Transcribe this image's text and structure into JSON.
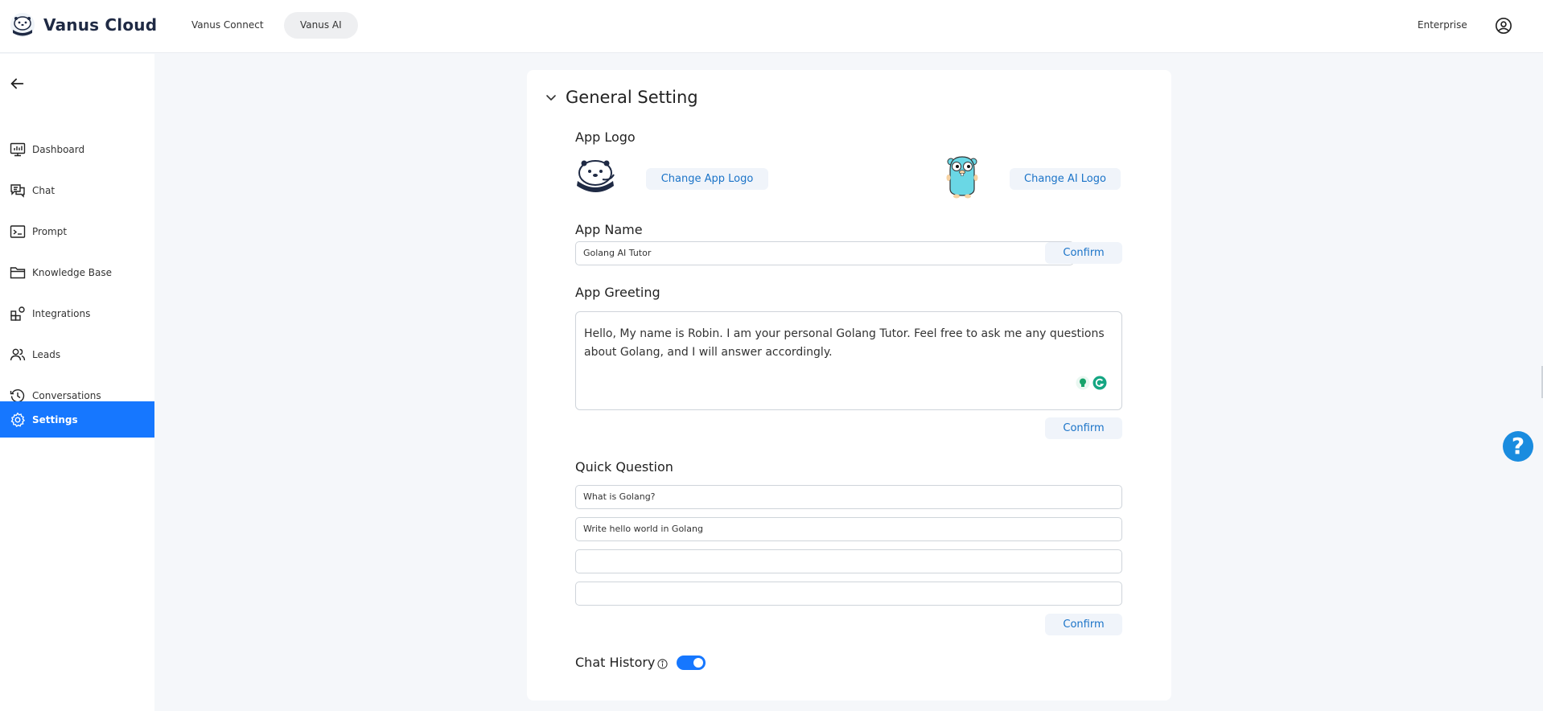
{
  "header": {
    "brand": "Vanus Cloud",
    "tabs": [
      {
        "label": "Vanus Connect",
        "active": false
      },
      {
        "label": "Vanus AI",
        "active": true
      }
    ],
    "enterprise": "Enterprise"
  },
  "sidebar": {
    "items": [
      {
        "label": "Dashboard",
        "icon": "dashboard-icon"
      },
      {
        "label": "Chat",
        "icon": "chat-icon"
      },
      {
        "label": "Prompt",
        "icon": "prompt-icon"
      },
      {
        "label": "Knowledge Base",
        "icon": "folder-icon"
      },
      {
        "label": "Integrations",
        "icon": "integrations-icon"
      },
      {
        "label": "Leads",
        "icon": "users-icon"
      },
      {
        "label": "Conversations",
        "icon": "history-icon"
      },
      {
        "label": "Settings",
        "icon": "gear-icon",
        "active": true
      }
    ]
  },
  "settings": {
    "section_title": "General Setting",
    "app_logo": {
      "label": "App Logo",
      "change_app_logo": "Change App Logo",
      "change_ai_logo": "Change AI Logo"
    },
    "app_name": {
      "label": "App Name",
      "value": "Golang AI Tutor",
      "confirm": "Confirm"
    },
    "app_greeting": {
      "label": "App Greeting",
      "value": "Hello, My name is Robin. I am your personal Golang Tutor. Feel free to ask me any questions about Golang, and I will answer accordingly.",
      "confirm": "Confirm"
    },
    "quick_question": {
      "label": "Quick Question",
      "items": [
        "What is Golang?",
        "Write hello world in Golang",
        "",
        ""
      ],
      "confirm": "Confirm"
    },
    "chat_history": {
      "label": "Chat History",
      "enabled": true
    }
  },
  "colors": {
    "accent": "#1677ff",
    "link": "#1a73c8",
    "help": "#1a8cdf"
  }
}
